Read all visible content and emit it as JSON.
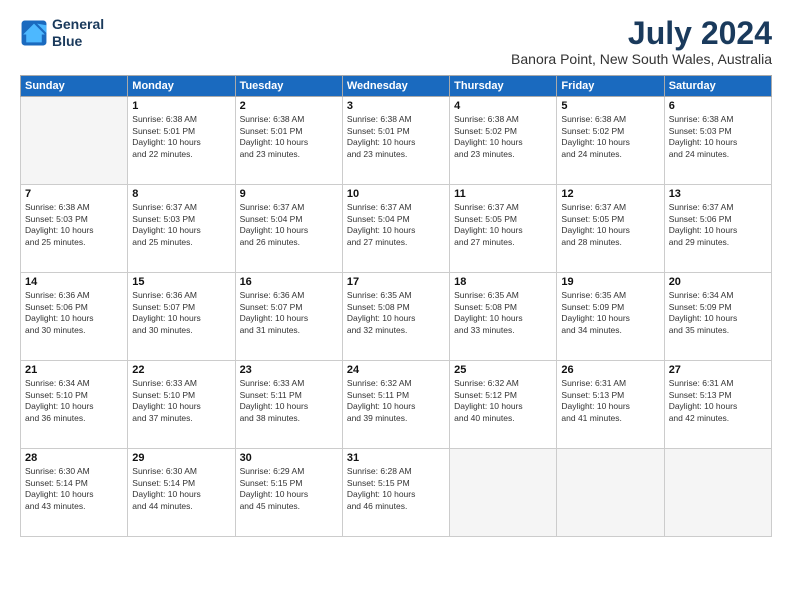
{
  "logo": {
    "line1": "General",
    "line2": "Blue"
  },
  "title": "July 2024",
  "location": "Banora Point, New South Wales, Australia",
  "weekdays": [
    "Sunday",
    "Monday",
    "Tuesday",
    "Wednesday",
    "Thursday",
    "Friday",
    "Saturday"
  ],
  "weeks": [
    [
      {
        "day": "",
        "text": ""
      },
      {
        "day": "1",
        "text": "Sunrise: 6:38 AM\nSunset: 5:01 PM\nDaylight: 10 hours\nand 22 minutes."
      },
      {
        "day": "2",
        "text": "Sunrise: 6:38 AM\nSunset: 5:01 PM\nDaylight: 10 hours\nand 23 minutes."
      },
      {
        "day": "3",
        "text": "Sunrise: 6:38 AM\nSunset: 5:01 PM\nDaylight: 10 hours\nand 23 minutes."
      },
      {
        "day": "4",
        "text": "Sunrise: 6:38 AM\nSunset: 5:02 PM\nDaylight: 10 hours\nand 23 minutes."
      },
      {
        "day": "5",
        "text": "Sunrise: 6:38 AM\nSunset: 5:02 PM\nDaylight: 10 hours\nand 24 minutes."
      },
      {
        "day": "6",
        "text": "Sunrise: 6:38 AM\nSunset: 5:03 PM\nDaylight: 10 hours\nand 24 minutes."
      }
    ],
    [
      {
        "day": "7",
        "text": "Sunrise: 6:38 AM\nSunset: 5:03 PM\nDaylight: 10 hours\nand 25 minutes."
      },
      {
        "day": "8",
        "text": "Sunrise: 6:37 AM\nSunset: 5:03 PM\nDaylight: 10 hours\nand 25 minutes."
      },
      {
        "day": "9",
        "text": "Sunrise: 6:37 AM\nSunset: 5:04 PM\nDaylight: 10 hours\nand 26 minutes."
      },
      {
        "day": "10",
        "text": "Sunrise: 6:37 AM\nSunset: 5:04 PM\nDaylight: 10 hours\nand 27 minutes."
      },
      {
        "day": "11",
        "text": "Sunrise: 6:37 AM\nSunset: 5:05 PM\nDaylight: 10 hours\nand 27 minutes."
      },
      {
        "day": "12",
        "text": "Sunrise: 6:37 AM\nSunset: 5:05 PM\nDaylight: 10 hours\nand 28 minutes."
      },
      {
        "day": "13",
        "text": "Sunrise: 6:37 AM\nSunset: 5:06 PM\nDaylight: 10 hours\nand 29 minutes."
      }
    ],
    [
      {
        "day": "14",
        "text": "Sunrise: 6:36 AM\nSunset: 5:06 PM\nDaylight: 10 hours\nand 30 minutes."
      },
      {
        "day": "15",
        "text": "Sunrise: 6:36 AM\nSunset: 5:07 PM\nDaylight: 10 hours\nand 30 minutes."
      },
      {
        "day": "16",
        "text": "Sunrise: 6:36 AM\nSunset: 5:07 PM\nDaylight: 10 hours\nand 31 minutes."
      },
      {
        "day": "17",
        "text": "Sunrise: 6:35 AM\nSunset: 5:08 PM\nDaylight: 10 hours\nand 32 minutes."
      },
      {
        "day": "18",
        "text": "Sunrise: 6:35 AM\nSunset: 5:08 PM\nDaylight: 10 hours\nand 33 minutes."
      },
      {
        "day": "19",
        "text": "Sunrise: 6:35 AM\nSunset: 5:09 PM\nDaylight: 10 hours\nand 34 minutes."
      },
      {
        "day": "20",
        "text": "Sunrise: 6:34 AM\nSunset: 5:09 PM\nDaylight: 10 hours\nand 35 minutes."
      }
    ],
    [
      {
        "day": "21",
        "text": "Sunrise: 6:34 AM\nSunset: 5:10 PM\nDaylight: 10 hours\nand 36 minutes."
      },
      {
        "day": "22",
        "text": "Sunrise: 6:33 AM\nSunset: 5:10 PM\nDaylight: 10 hours\nand 37 minutes."
      },
      {
        "day": "23",
        "text": "Sunrise: 6:33 AM\nSunset: 5:11 PM\nDaylight: 10 hours\nand 38 minutes."
      },
      {
        "day": "24",
        "text": "Sunrise: 6:32 AM\nSunset: 5:11 PM\nDaylight: 10 hours\nand 39 minutes."
      },
      {
        "day": "25",
        "text": "Sunrise: 6:32 AM\nSunset: 5:12 PM\nDaylight: 10 hours\nand 40 minutes."
      },
      {
        "day": "26",
        "text": "Sunrise: 6:31 AM\nSunset: 5:13 PM\nDaylight: 10 hours\nand 41 minutes."
      },
      {
        "day": "27",
        "text": "Sunrise: 6:31 AM\nSunset: 5:13 PM\nDaylight: 10 hours\nand 42 minutes."
      }
    ],
    [
      {
        "day": "28",
        "text": "Sunrise: 6:30 AM\nSunset: 5:14 PM\nDaylight: 10 hours\nand 43 minutes."
      },
      {
        "day": "29",
        "text": "Sunrise: 6:30 AM\nSunset: 5:14 PM\nDaylight: 10 hours\nand 44 minutes."
      },
      {
        "day": "30",
        "text": "Sunrise: 6:29 AM\nSunset: 5:15 PM\nDaylight: 10 hours\nand 45 minutes."
      },
      {
        "day": "31",
        "text": "Sunrise: 6:28 AM\nSunset: 5:15 PM\nDaylight: 10 hours\nand 46 minutes."
      },
      {
        "day": "",
        "text": ""
      },
      {
        "day": "",
        "text": ""
      },
      {
        "day": "",
        "text": ""
      }
    ]
  ]
}
